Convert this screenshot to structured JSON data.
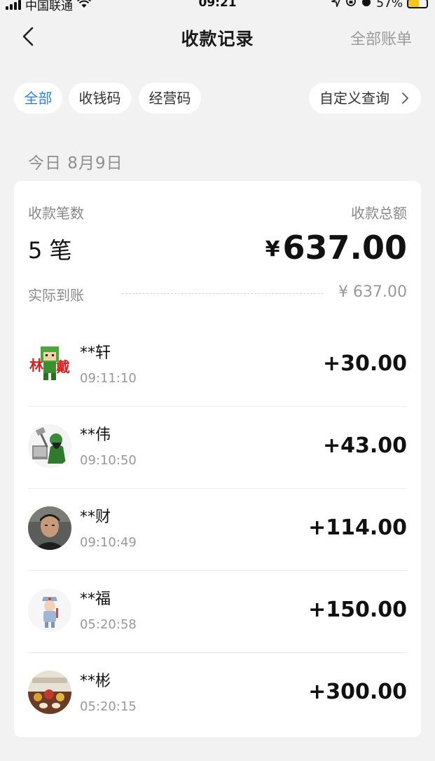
{
  "status_bar": {
    "carrier": "中国联通",
    "time": "09:21",
    "battery": "57%"
  },
  "header": {
    "title": "收款记录",
    "right_link": "全部账单"
  },
  "filters": {
    "all": "全部",
    "qr": "收钱码",
    "business": "经营码",
    "custom": "自定义查询",
    "active_color": "#2d7ff0"
  },
  "date_label": "今日 8月9日",
  "summary": {
    "count_label": "收款笔数",
    "count_value": "5",
    "count_unit": "笔",
    "total_label": "收款总额",
    "currency": "¥",
    "total_value": "637.00",
    "actual_label": "实际到账",
    "actual_value": "¥ 637.00"
  },
  "transactions": [
    {
      "name": "**轩",
      "time": "09:11:10",
      "amount": "+30.00",
      "avatar": "pixel-character-avatar"
    },
    {
      "name": "**伟",
      "time": "09:10:50",
      "amount": "+43.00",
      "avatar": "cartoon-warrior-avatar"
    },
    {
      "name": "**财",
      "time": "09:10:49",
      "amount": "+114.00",
      "avatar": "person-photo-avatar"
    },
    {
      "name": "**福",
      "time": "05:20:58",
      "amount": "+150.00",
      "avatar": "soldier-cartoon-avatar"
    },
    {
      "name": "**彬",
      "time": "05:20:15",
      "amount": "+300.00",
      "avatar": "tea-set-photo-avatar"
    }
  ]
}
